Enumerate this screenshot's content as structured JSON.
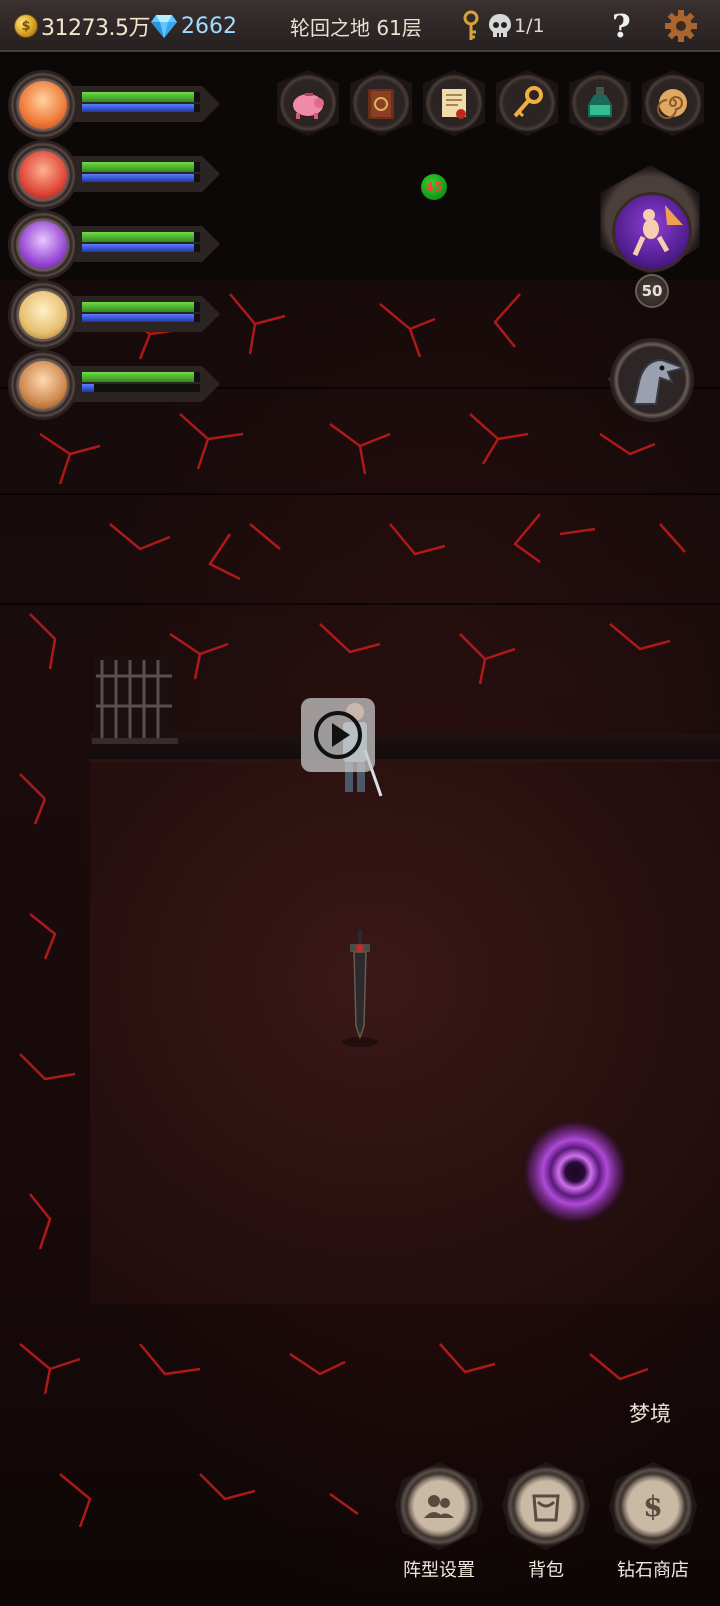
{
  "topbar": {
    "gold_icon_glyph": "$",
    "gold": "31273.5万",
    "diamonds": "2662",
    "stage": "轮回之地 61层",
    "skull_count": "1/1",
    "help_label": "?"
  },
  "heroes": [
    {
      "name": "hero-1",
      "hp": 0.95,
      "mp": 0.95,
      "color": "#f07a3a"
    },
    {
      "name": "hero-2",
      "hp": 0.95,
      "mp": 0.95,
      "color": "#e0483a"
    },
    {
      "name": "hero-3",
      "hp": 0.95,
      "mp": 0.95,
      "color": "#9a4ad6"
    },
    {
      "name": "hero-4",
      "hp": 0.95,
      "mp": 0.95,
      "color": "#e8c070"
    },
    {
      "name": "hero-5",
      "hp": 0.95,
      "mp": 0.1,
      "color": "#d08a50"
    }
  ],
  "items": [
    "piggy-bank-icon",
    "spellbook-icon",
    "scroll-icon",
    "golden-key-icon",
    "potion-bottle-icon",
    "spiral-shell-icon"
  ],
  "badge_count": "45",
  "boss_level": "50",
  "dream_label": "梦境",
  "bottom_buttons": [
    {
      "label": "阵型设置",
      "icon": "team-formation-icon"
    },
    {
      "label": "背包",
      "icon": "backpack-icon"
    },
    {
      "label": "钻石商店",
      "icon": "dollar-shop-icon"
    }
  ],
  "colors": {
    "hp_bar": "#4fbf2a",
    "mp_bar": "#3352d8",
    "diamond_text": "#9fdcff",
    "portal": "#b04ad8"
  }
}
